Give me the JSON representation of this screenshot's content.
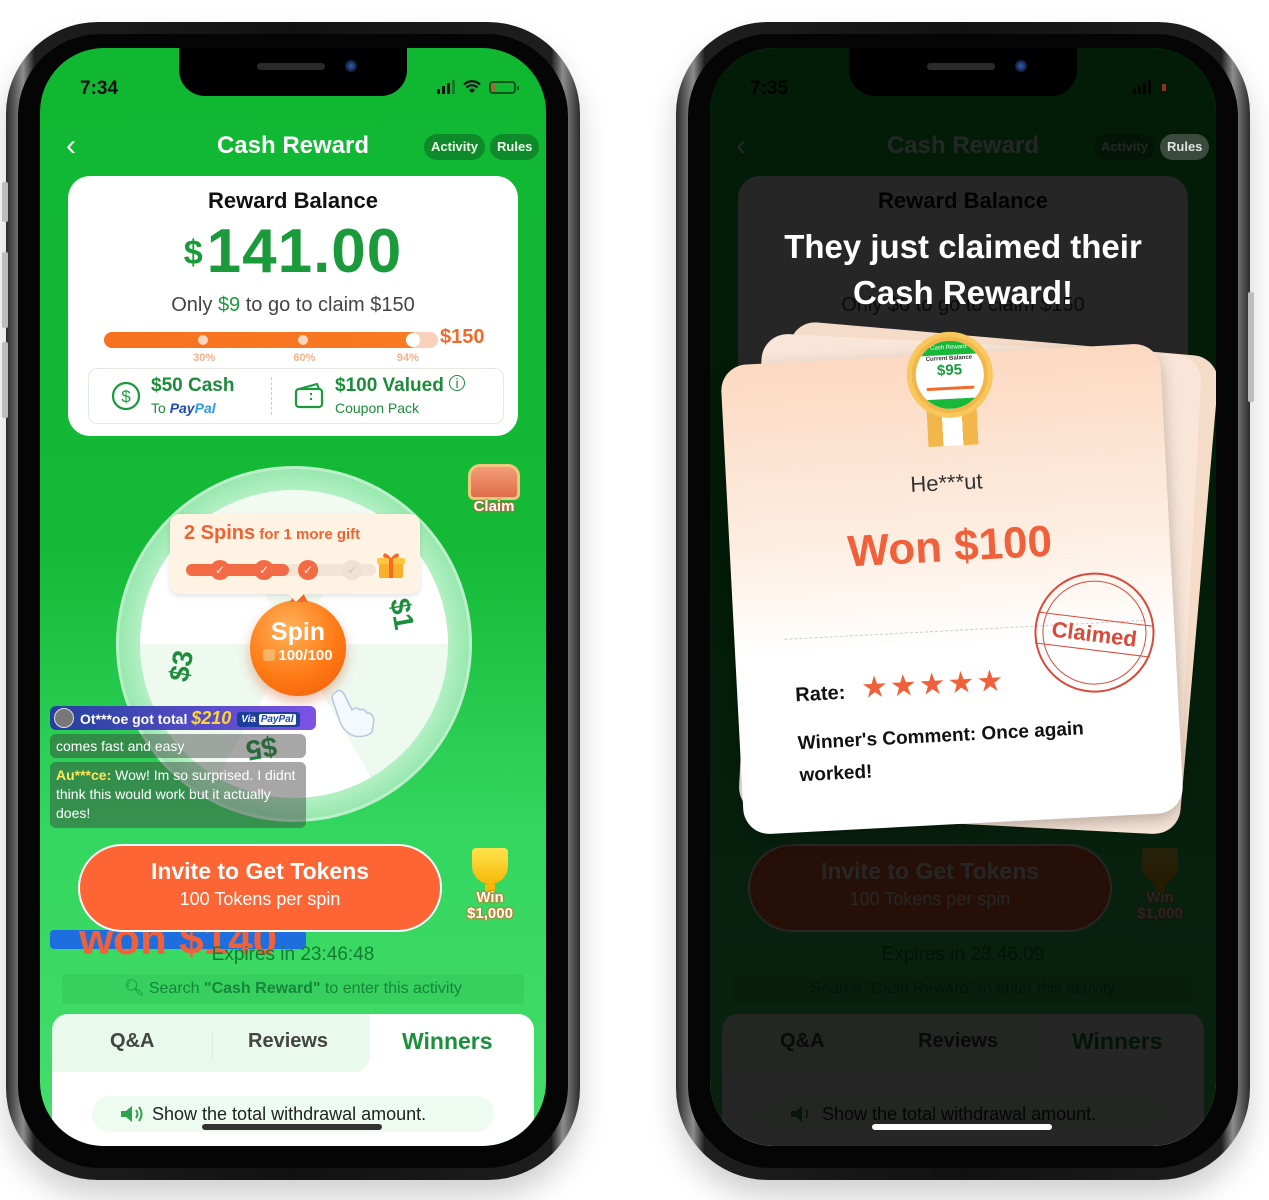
{
  "phones": [
    {
      "status": {
        "time": "7:34"
      },
      "nav": {
        "title": "Cash Reward",
        "activity": "Activity",
        "rules": "Rules"
      },
      "balance": {
        "label": "Reward Balance",
        "currency": "$",
        "amount": "141.00",
        "togo_prefix": "Only ",
        "togo_amount": "$9",
        "togo_suffix": " to go to claim $150",
        "progress_percent": 94,
        "milestones": [
          "30%",
          "60%",
          "94%"
        ],
        "goal": "$150",
        "rewards": [
          {
            "title": "$50 Cash",
            "sub_prefix": "To ",
            "sub_brand_1": "Pay",
            "sub_brand_2": "Pal"
          },
          {
            "title": "$100 Valued",
            "sub": "Coupon Pack"
          }
        ]
      },
      "spins_tip": {
        "count": "2 Spins",
        "text": " for 1 more gift",
        "completed_steps": 3,
        "total_steps": 4
      },
      "chest": {
        "label": "Claim"
      },
      "wheel": {
        "prizes": [
          "$1",
          "$3",
          "$5",
          "$"
        ],
        "spin_label": "Spin",
        "tokens": "100/100"
      },
      "feed": [
        {
          "user": "Ot***oe got total ",
          "amount": "$210",
          "via": "Via",
          "brand": "PayPal"
        },
        {
          "text": "comes fast and easy"
        },
        {
          "badge": "won $140",
          "user": "Au***ce:",
          "text": " Wow! Im so surprised. I didnt think this would work but it actually does!"
        }
      ],
      "invite": {
        "title": "Invite to Get Tokens",
        "subtitle": "100 Tokens per spin"
      },
      "trophy": {
        "line1": "Win",
        "line2": "$1,000"
      },
      "expires": "Expires in 23:46:48",
      "search_hint": {
        "prefix": "Search ",
        "term": "\"Cash Reward\"",
        "suffix": " to enter this activity"
      },
      "tabs": [
        {
          "label": "Q&A",
          "active": false
        },
        {
          "label": "Reviews",
          "active": false
        },
        {
          "label": "Winners",
          "active": true
        }
      ],
      "notice": "Show the total withdrawal amount."
    },
    {
      "status": {
        "time": "7:35"
      },
      "nav": {
        "title": "Cash Reward",
        "activity": "Activity",
        "rules": "Rules"
      },
      "balance": {
        "label": "Reward Balance",
        "togo": "Only $6 to go to claim $150"
      },
      "invite": {
        "title": "Invite to Get Tokens",
        "subtitle": "100 Tokens per spin"
      },
      "trophy": {
        "line1": "Win",
        "line2": "$1,000"
      },
      "expires": "Expires in 23:46:09",
      "search_hint": "Search \"Cash Reward\" to enter this activity",
      "tabs": [
        {
          "label": "Q&A"
        },
        {
          "label": "Reviews"
        },
        {
          "label": "Winners"
        }
      ],
      "notice": "Show the total withdrawal amount.",
      "popup": {
        "headline_1": "They just claimed their",
        "headline_2": "Cash Reward!",
        "medal": {
          "header": "Cash Reward",
          "label": "Current Balance",
          "amount": "$95"
        },
        "winner": "He***ut",
        "won": "Won $100",
        "stamp": "Claimed",
        "rate_label": "Rate:",
        "rating": 5,
        "rating_max": 5,
        "stars": "★★★★★",
        "comment": "Winner's Comment: Once again worked!"
      }
    }
  ],
  "colors": {
    "brand_green": "#14b936",
    "accent_orange": "#fd6534",
    "text_green": "#1b9a3c"
  }
}
